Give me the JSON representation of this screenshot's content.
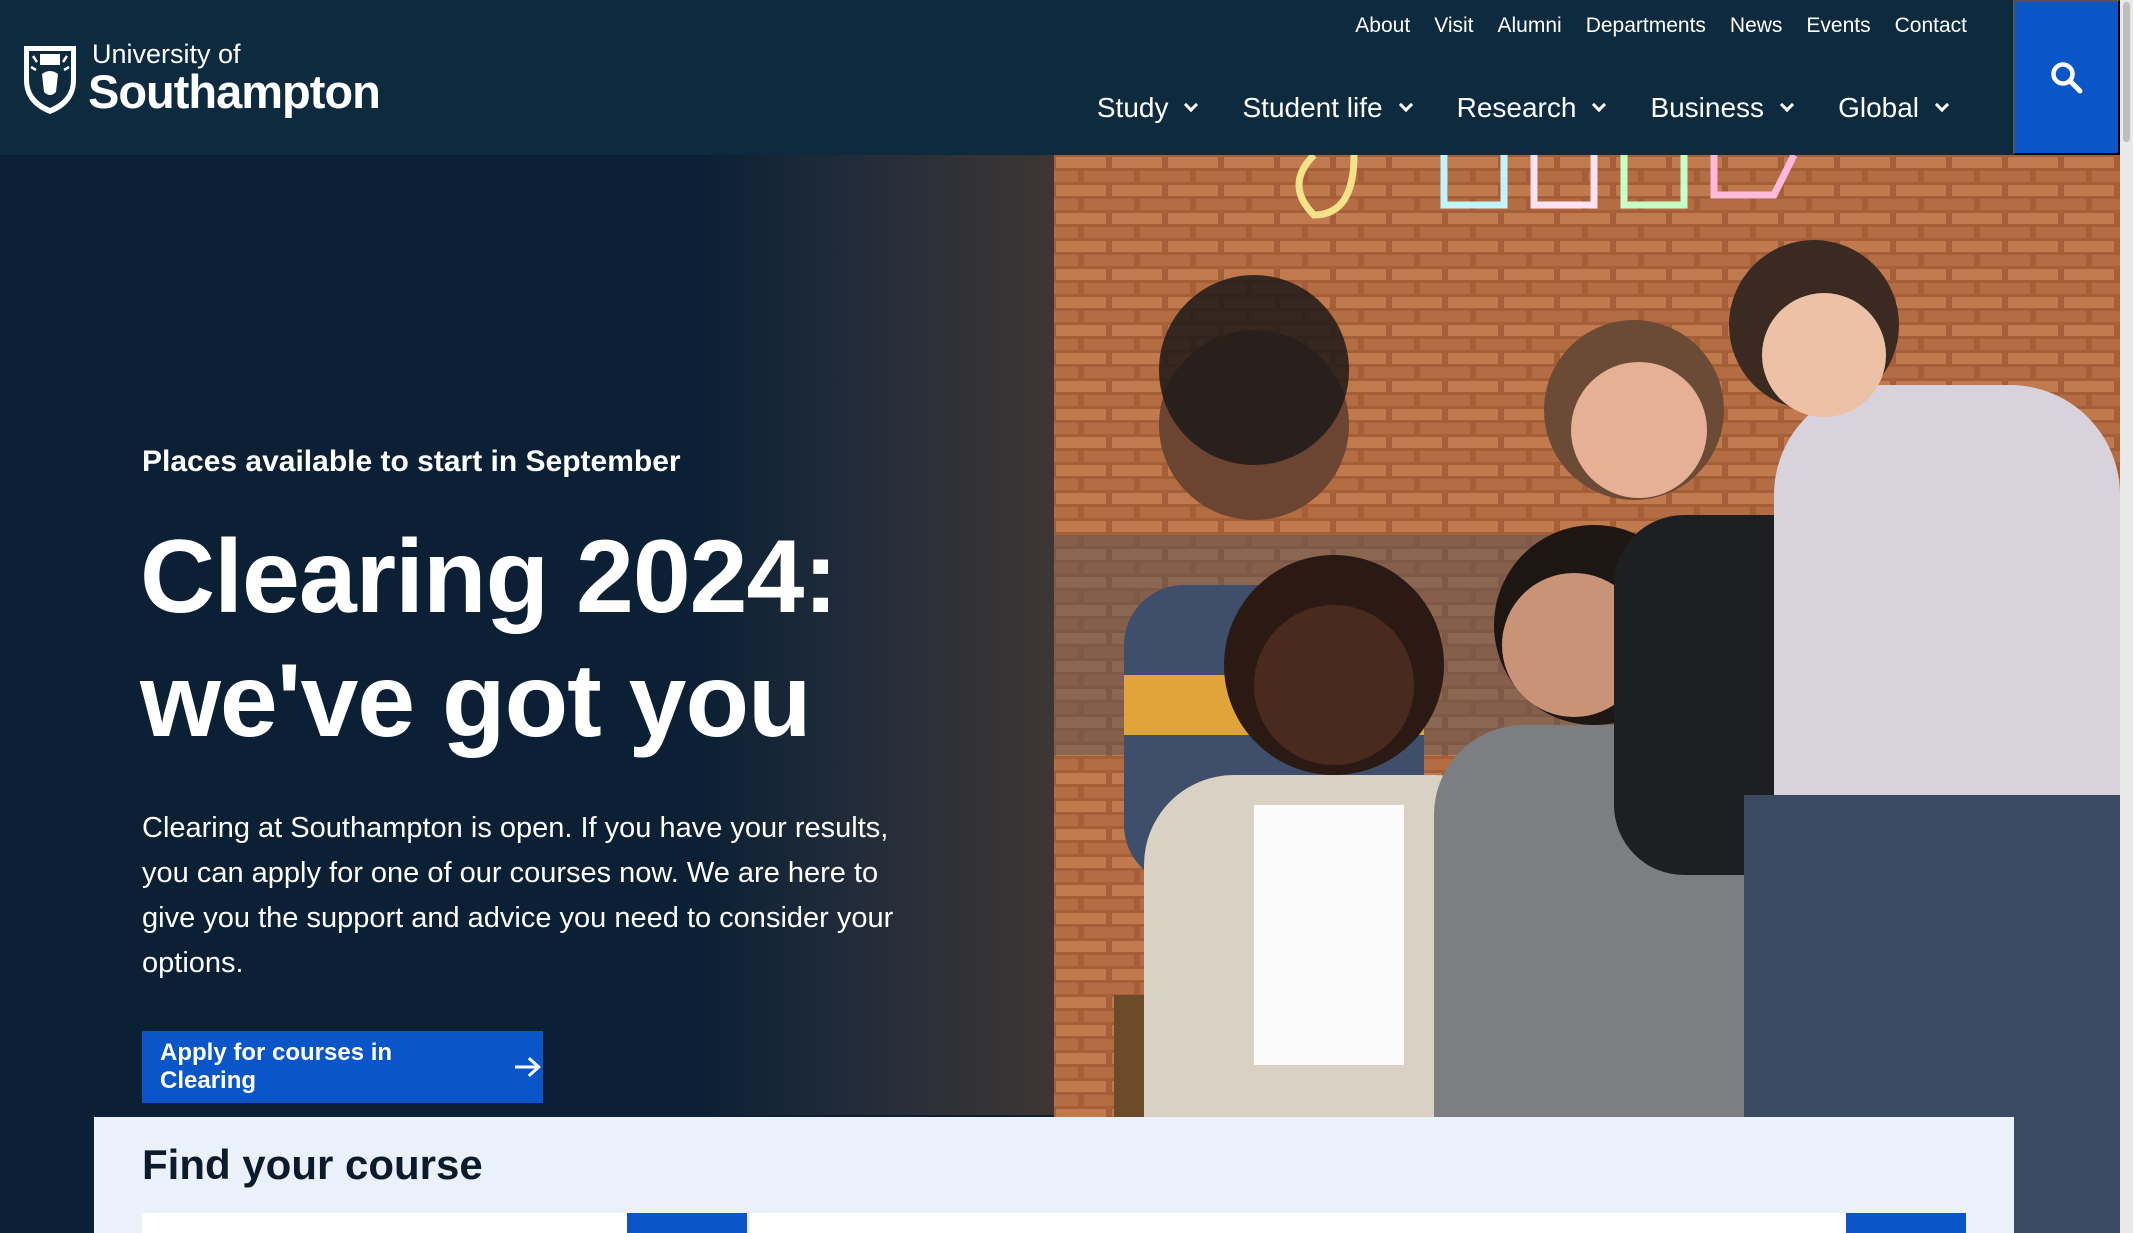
{
  "brand": {
    "line1": "University of",
    "line2": "Southampton"
  },
  "utility_nav": [
    "About",
    "Visit",
    "Alumni",
    "Departments",
    "News",
    "Events",
    "Contact"
  ],
  "main_nav": [
    "Study",
    "Student life",
    "Research",
    "Business",
    "Global"
  ],
  "hero": {
    "kicker": "Places available to start in September",
    "title_line1": "Clearing 2024:",
    "title_line2": "we've got you",
    "body": "Clearing at Southampton is open. If you have your results, you can apply for one of our courses now. We are here to give you the support and advice you need to consider your options.",
    "cta_label": "Apply for courses in Clearing"
  },
  "find_course": {
    "title": "Find your course"
  },
  "colors": {
    "header_bg": "#0e2a3f",
    "hero_bg": "#0b2034",
    "accent": "#0a55c8",
    "panel_bg": "#eaf1fb"
  },
  "icons": {
    "search": "search-icon",
    "crest": "crest-logo-icon",
    "arrow": "arrow-right-icon",
    "chevron": "chevron-down-icon"
  }
}
